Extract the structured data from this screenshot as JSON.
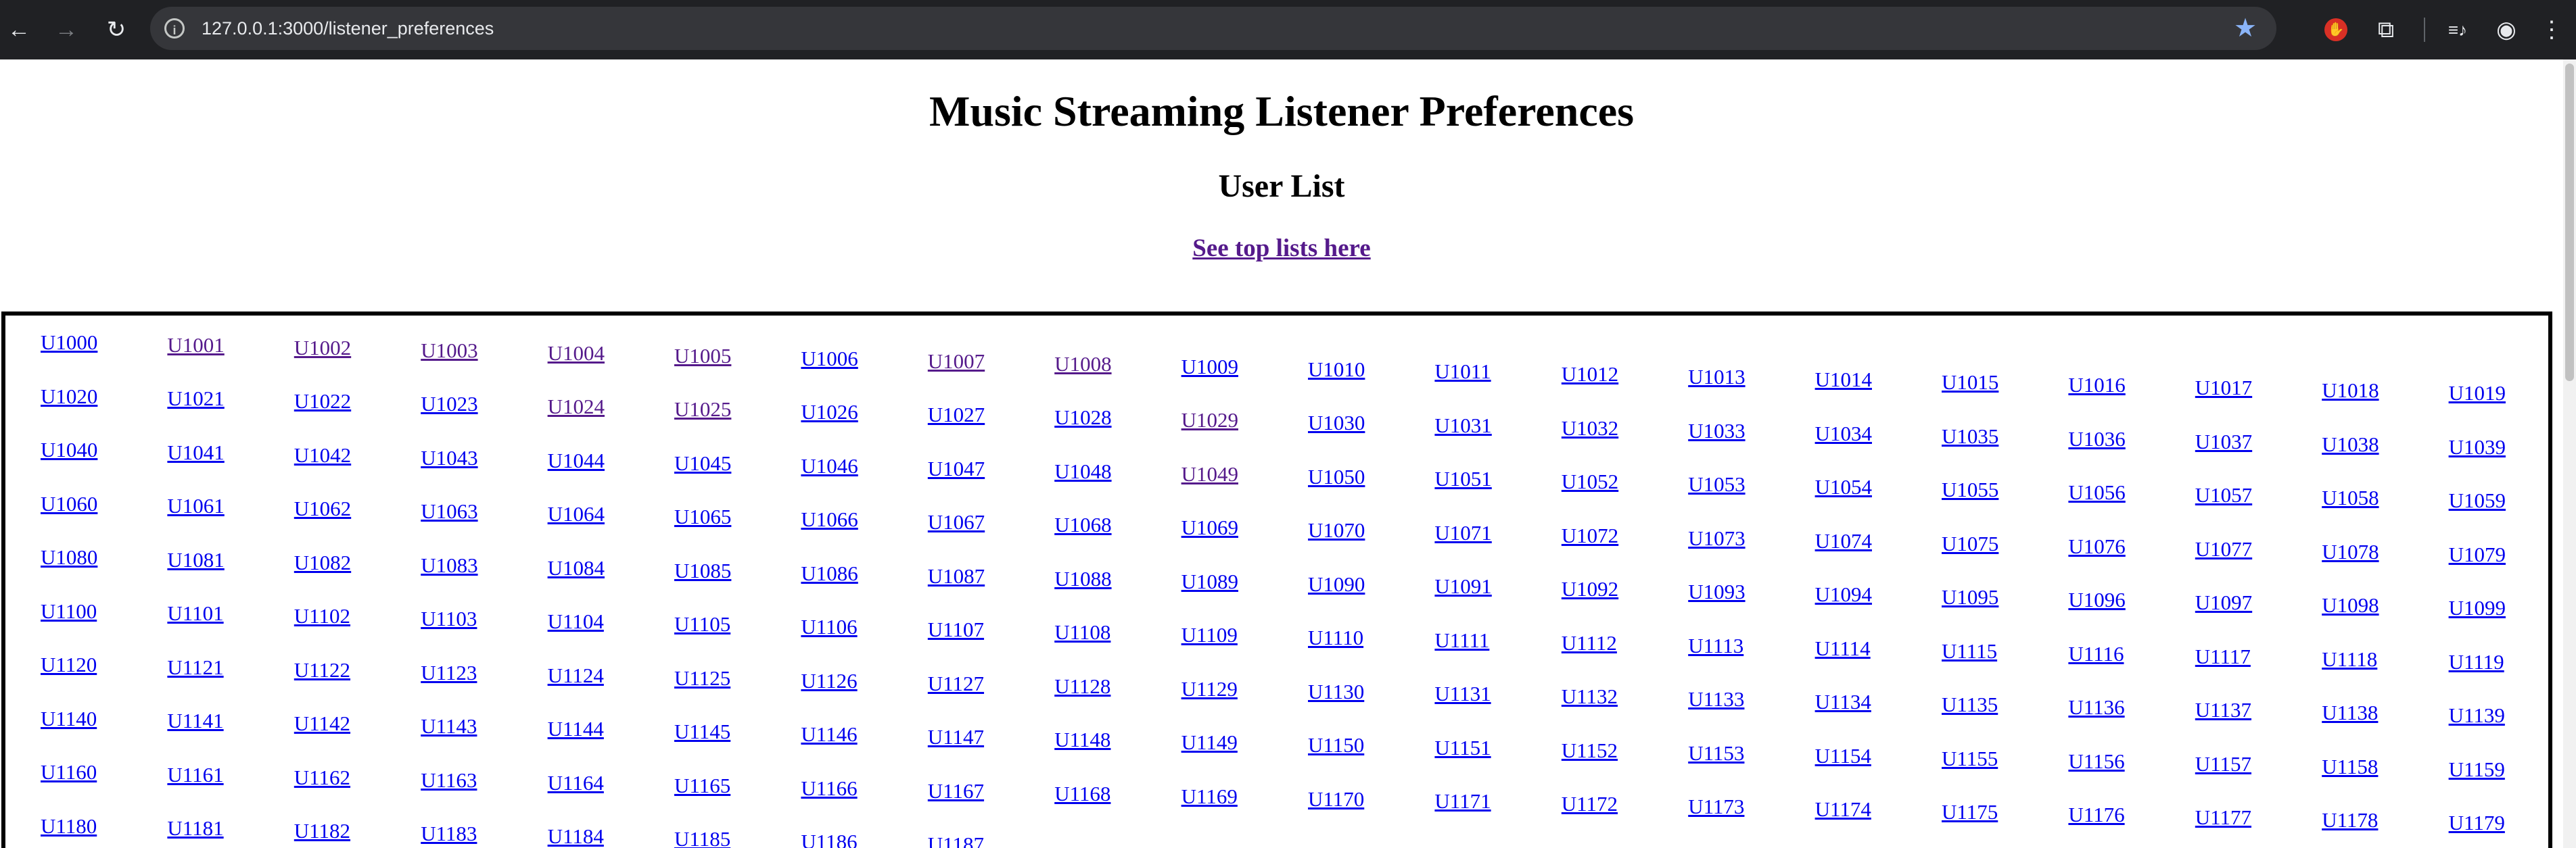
{
  "browser": {
    "url": "127.0.0.1:3000/listener_preferences",
    "back_icon": "←",
    "forward_icon": "→",
    "reload_icon": "↻",
    "site_info_icon": "i",
    "bookmark_icon": "★",
    "extension_stop_icon": "✋",
    "extensions_icon": "⧉",
    "media_icon": "≡♪",
    "profile_icon": "◉",
    "menu_icon": "⋮"
  },
  "page": {
    "title": "Music Streaming Listener Preferences",
    "subtitle": "User List",
    "top_link": "See top lists here"
  },
  "users": {
    "prefix": "U",
    "first_id": 1000,
    "last_visible_id": 1187,
    "columns": 20,
    "visited": [
      "U1001",
      "U1002",
      "U1003",
      "U1004",
      "U1005",
      "U1007",
      "U1008",
      "U1024",
      "U1025",
      "U1029",
      "U1049"
    ]
  },
  "colors": {
    "link": "#0000ee",
    "visited_link": "#551a8b",
    "chrome_bg": "#202124",
    "omnibox_bg": "#35363a"
  }
}
